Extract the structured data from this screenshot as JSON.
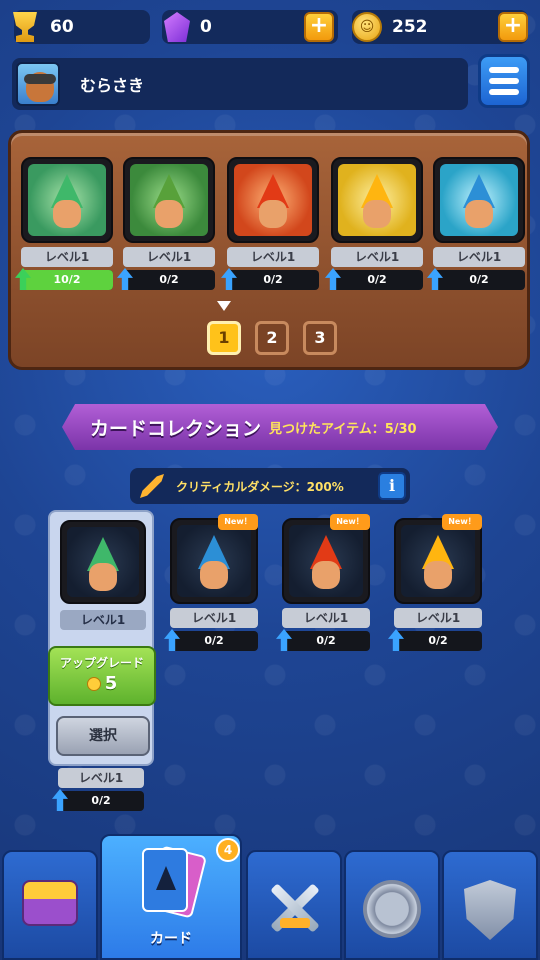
{
  "resources": {
    "trophies": "60",
    "gems": "0",
    "gold": "252",
    "plus_symbol": "+"
  },
  "profile": {
    "player_name": "むらさき"
  },
  "deck": {
    "slots": [
      {
        "level": "レベル1",
        "progress": "10/2",
        "progress_ratio": 1.0,
        "upgradable": true,
        "theme": "green"
      },
      {
        "level": "レベル1",
        "progress": "0/2",
        "progress_ratio": 0,
        "upgradable": false,
        "theme": "greenpot"
      },
      {
        "level": "レベル1",
        "progress": "0/2",
        "progress_ratio": 0,
        "upgradable": false,
        "theme": "red"
      },
      {
        "level": "レベル1",
        "progress": "0/2",
        "progress_ratio": 0,
        "upgradable": false,
        "theme": "yellow"
      },
      {
        "level": "レベル1",
        "progress": "0/2",
        "progress_ratio": 0,
        "upgradable": false,
        "theme": "blue"
      }
    ],
    "pages": [
      "1",
      "2",
      "3"
    ],
    "active_page": "1"
  },
  "collection": {
    "title": "カードコレクション",
    "items_found": "見つけたアイテム：5/30",
    "critical_damage": "クリティカルダメージ：200%",
    "info_symbol": "i",
    "selected_card": {
      "level": "レベル1",
      "upgrade_label": "アップグレード",
      "upgrade_cost": "5",
      "select_label": "選択",
      "under_level": "レベル1",
      "under_progress": "0/2"
    },
    "cards": [
      {
        "badge": "New！",
        "level": "レベル1",
        "progress": "0/2",
        "theme": "blue"
      },
      {
        "badge": "New！",
        "level": "レベル1",
        "progress": "0/2",
        "theme": "red"
      },
      {
        "badge": "New！",
        "level": "レベル1",
        "progress": "0/2",
        "theme": "yellow"
      }
    ]
  },
  "bottom_nav": {
    "tabs": [
      {
        "name": "chest",
        "label": ""
      },
      {
        "name": "cards",
        "label": "カード",
        "badge": "4",
        "active": true
      },
      {
        "name": "battle",
        "label": ""
      },
      {
        "name": "rank",
        "label": ""
      },
      {
        "name": "clan",
        "label": ""
      }
    ]
  },
  "colors": {
    "background": "#1e4594",
    "accent_gold": "#ffc21a",
    "banner_purple": "#9b48c4",
    "upgrade_green": "#5eb22d"
  }
}
